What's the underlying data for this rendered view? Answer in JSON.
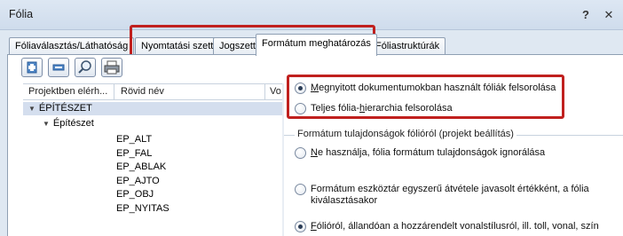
{
  "window": {
    "title": "Fólia",
    "help_label": "?",
    "close_label": "✕"
  },
  "tabs": [
    {
      "label": "Fóliaválasztás/Láthatóság",
      "active": false
    },
    {
      "label": "Nyomtatási szett",
      "active": false
    },
    {
      "label": "Jogszett",
      "active": false
    },
    {
      "label": "Formátum meghatározás",
      "active": true
    },
    {
      "label": "Fóliastruktúrák",
      "active": false
    }
  ],
  "toolbar": {
    "icons": [
      "add-icon",
      "remove-icon",
      "search-icon",
      "print-icon"
    ]
  },
  "list": {
    "columns": [
      "Projektben elérh...",
      "Rövid név",
      "Vo"
    ],
    "tree": {
      "root": "ÉPÍTÉSZET",
      "child": "Építészet",
      "items": [
        "EP_ALT",
        "EP_FAL",
        "EP_ABLAK",
        "EP_AJTO",
        "EP_OBJ",
        "EP_NYITAS"
      ]
    }
  },
  "list_scope": {
    "options": [
      {
        "label": "Megnyitott dokumentumokban használt fóliák felsorolása",
        "checked": true
      },
      {
        "label": "Teljes fólia-hierarchia felsorolása",
        "checked": false
      }
    ]
  },
  "format_group": {
    "title": "Formátum tulajdonságok fólióról (projekt beállítás)",
    "options": [
      {
        "label": "Ne használja, fólia formátum tulajdonságok ignorálása",
        "checked": false
      },
      {
        "label_line1": "Formátum eszköztár egyszerű átvétele javasolt értékként, a fólia",
        "label_line2": "kiválasztásakor",
        "checked": false
      },
      {
        "label": "Fólióról, állandóan a hozzárendelt vonalstílusról, ill. toll, vonal, szín",
        "checked": true
      }
    ]
  },
  "colors": {
    "highlight_box": "#c0201e",
    "selection": "#d4deee",
    "titlebar": "#d7e2ef"
  }
}
